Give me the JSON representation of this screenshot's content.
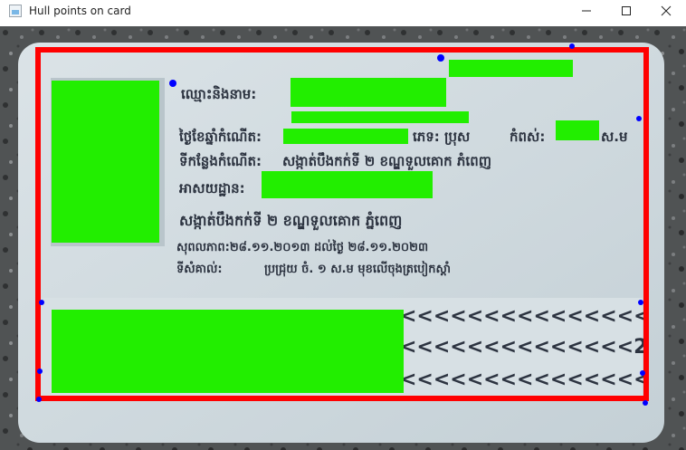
{
  "window": {
    "title": "Hull points on card",
    "minimize_icon": "minimize-icon",
    "maximize_icon": "maximize-icon",
    "close_icon": "close-icon"
  },
  "colors": {
    "hull_outline": "#ff0000",
    "hull_points": "#0000ff",
    "redaction": "#22ee00",
    "card": "#cfd9de",
    "background": "#4d4f50"
  },
  "card_text": {
    "name_label": "ឈ្មោះនិងនាម:",
    "dob_label": "ថ្ងៃខែឆ្នាំកំណើត:",
    "sex_label": "ភេទ: ប្រុស",
    "height_label": "កំពស់:",
    "height_unit": "ស.ម",
    "birthplace_label": "ទីកន្លែងកំណើត:",
    "birthplace_value": "សង្កាត់បឹងកក់ទី ២ ខណ្ឌទួលគោក ភំពេញ",
    "address_label": "អាសយដ្ឋាន:",
    "address_value": "សង្កាត់បឹងកក់ទី ២ ខណ្ឌទួលគោក ភ្នំពេញ",
    "validity": "សុពលភាព:២៨.១១.២០១៣ ដល់ថ្ងៃ ២៨.១១.២០២៣",
    "identity_label": "ទីសំគាល់:",
    "identity_value": "ប្រជ្រុយ ចំ. ១ ស.ម មុខលើចុងត្របៀកស្តាំ",
    "mrz_line_1": "<<<<<<<<<<<<<<<",
    "mrz_line_2": "<<<<<<<<<<<<<<2",
    "mrz_line_3": "<<<<<<<<<<<<<<<"
  }
}
